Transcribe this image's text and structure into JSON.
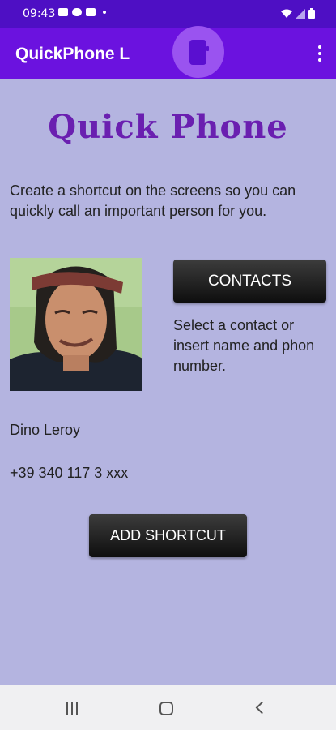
{
  "status_bar": {
    "time": "09:43"
  },
  "app_bar": {
    "title": "QuickPhone L"
  },
  "content": {
    "heading": "Quick Phone",
    "description": "Create a shortcut on the screens so you can quickly call an important person for you.",
    "contacts_button": "CONTACTS",
    "hint": "Select a contact or insert name and phon number.",
    "name_value": "Dino Leroy",
    "phone_value": "+39 340 117 3 xxx",
    "add_button": "ADD SHORTCUT"
  },
  "icons": {
    "status_left": [
      "image-icon",
      "cloud-icon",
      "youtube-icon",
      "dot-icon"
    ],
    "status_right": [
      "wifi-icon",
      "signal-icon",
      "battery-icon"
    ],
    "app_bar": [
      "phone-icon",
      "more-vert-icon"
    ],
    "nav": [
      "recents-icon",
      "home-icon",
      "back-icon"
    ]
  },
  "colors": {
    "status_bar": "#4e0fc4",
    "app_bar": "#6b12df",
    "background": "#b4b4e0",
    "heading": "#6a1fb0",
    "button": "#1a1a1a"
  }
}
